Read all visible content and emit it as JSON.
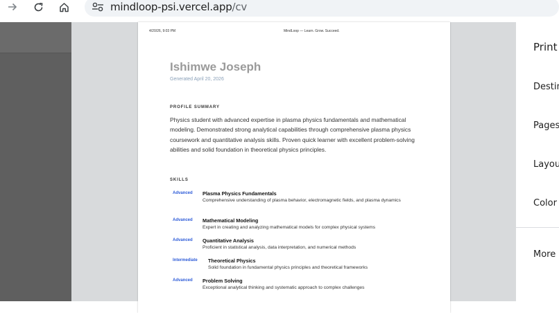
{
  "browser": {
    "url_host": "mindloop-psi.vercel.app",
    "url_path": "/cv"
  },
  "page_header": {
    "timestamp": "4/20/26, 9:03 PM",
    "site_title": "MindLoop — Learn. Grow. Succeed."
  },
  "cv": {
    "name": "Ishimwe Joseph",
    "generated": "Generated April 20, 2026",
    "summary_title": "PROFILE SUMMARY",
    "summary_text": "Physics student with advanced expertise in plasma physics fundamentals and mathematical modeling. Demonstrated strong analytical capabilities through comprehensive plasma physics coursework and quantitative analysis skills. Proven quick learner with excellent problem-solving abilities and solid foundation in theoretical physics principles.",
    "skills_title": "SKILLS",
    "skills": [
      {
        "level": "Advanced",
        "name": "Plasma Physics Fundamentals",
        "desc": "Comprehensive understanding of plasma behavior, electromagnetic fields, and plasma dynamics"
      },
      {
        "level": "Advanced",
        "name": "Mathematical Modeling",
        "desc": "Expert in creating and analyzing mathematical models for complex physical systems"
      },
      {
        "level": "Advanced",
        "name": "Quantitative Analysis",
        "desc": "Proficient in statistical analysis, data interpretation, and numerical methods"
      },
      {
        "level": "Intermediate",
        "name": "Theoretical Physics",
        "desc": "Solid foundation in fundamental physics principles and theoretical frameworks"
      },
      {
        "level": "Advanced",
        "name": "Problem Solving",
        "desc": "Exceptional analytical thinking and systematic approach to complex challenges"
      }
    ]
  },
  "print_panel": {
    "title": "Print",
    "destination": "Destin",
    "pages": "Pages",
    "layout": "Layou",
    "color": "Color",
    "more": "More s"
  },
  "colors": {
    "level_blue": "#2d5bd8",
    "name_gray": "#9a9a9a",
    "preview_bg": "#d8dadc",
    "left_panel": "#5f5f5f"
  }
}
